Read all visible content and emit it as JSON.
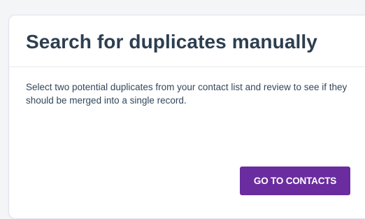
{
  "card": {
    "title": "Search for duplicates manually",
    "description": "Select two potential duplicates from your contact list and review to see if they should be merged into a single record.",
    "button_label": "GO TO CONTACTS"
  },
  "colors": {
    "page_background": "#f4f5f7",
    "card_background": "#ffffff",
    "title_text": "#2d3e50",
    "body_text": "#33475b",
    "button_background": "#6a2c9e",
    "button_text": "#ffffff"
  }
}
